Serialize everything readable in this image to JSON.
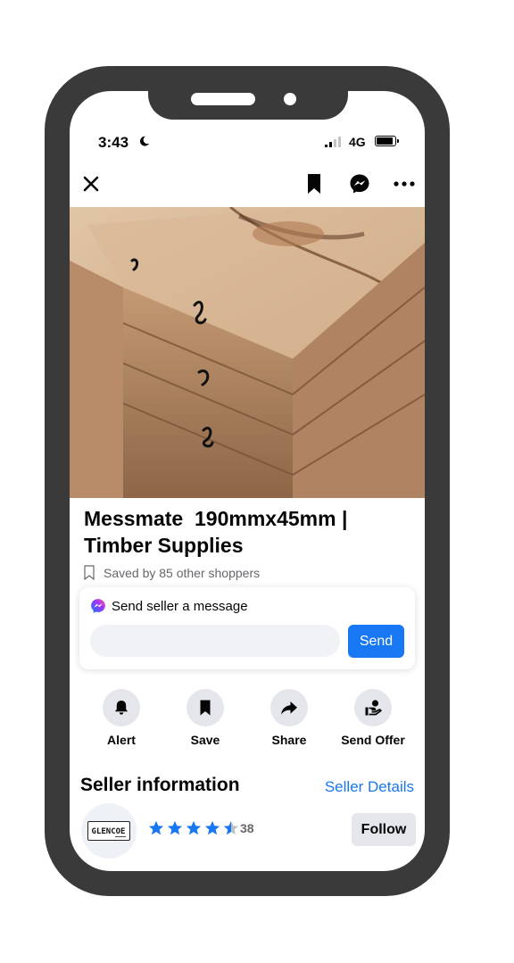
{
  "status_bar": {
    "time": "3:43",
    "network": "4G"
  },
  "listing": {
    "title": "Messmate  190mmx45mm |\nTimber Supplies",
    "saved_text": "Saved by 85 other shoppers"
  },
  "message": {
    "title": "Send seller a message",
    "input_value": "",
    "send_label": "Send"
  },
  "actions": [
    {
      "label": "Alert",
      "icon": "bell-icon"
    },
    {
      "label": "Save",
      "icon": "bookmark-icon"
    },
    {
      "label": "Share",
      "icon": "share-icon"
    },
    {
      "label": "Send Offer",
      "icon": "hand-offer-icon"
    }
  ],
  "seller": {
    "heading": "Seller information",
    "details_link": "Seller Details",
    "logo_text": "GLENCOE",
    "rating": 4.5,
    "rating_count": "38",
    "follow_label": "Follow"
  },
  "colors": {
    "accent": "#1877f2",
    "frame": "#3a3a3a",
    "muted_text": "#65676b",
    "button_gray": "#e4e6eb"
  }
}
